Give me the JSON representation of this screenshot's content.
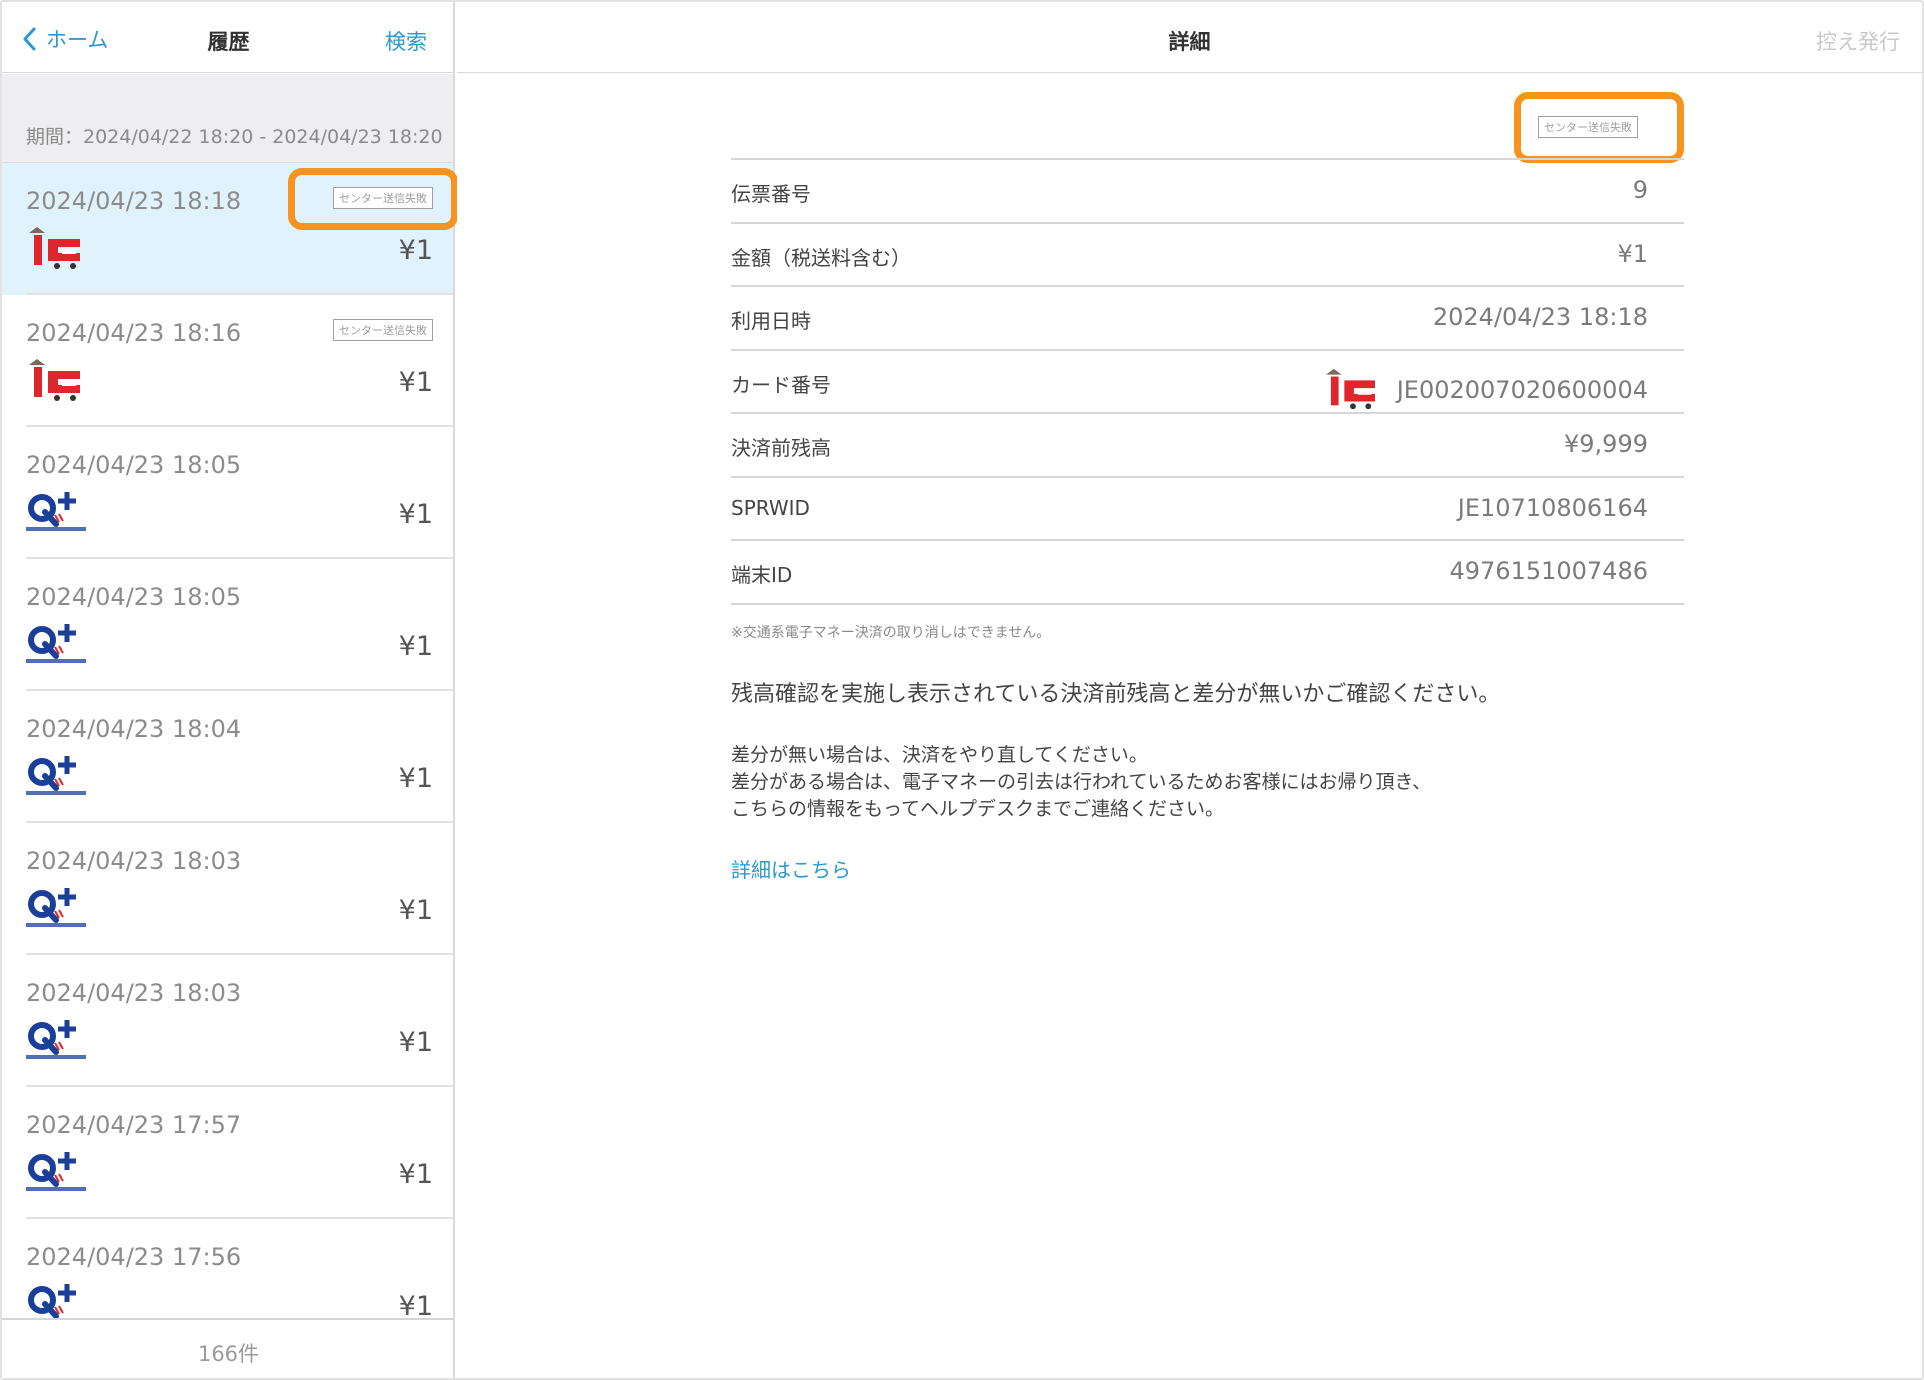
{
  "left_pane": {
    "back_label": "ホーム",
    "title": "履歴",
    "search_label": "検索",
    "period": "期間：2024/04/22 18:20 - 2024/04/23 18:20",
    "transactions": [
      {
        "time": "2024/04/23 18:18",
        "amount": "¥1",
        "logo": "ic-card-icon",
        "badge": "センター送信失敗",
        "selected": true
      },
      {
        "time": "2024/04/23 18:16",
        "amount": "¥1",
        "logo": "ic-card-icon",
        "badge": "センター送信失敗",
        "selected": false
      },
      {
        "time": "2024/04/23 18:05",
        "amount": "¥1",
        "logo": "quicpay-icon",
        "badge": "",
        "selected": false
      },
      {
        "time": "2024/04/23 18:05",
        "amount": "¥1",
        "logo": "quicpay-icon",
        "badge": "",
        "selected": false
      },
      {
        "time": "2024/04/23 18:04",
        "amount": "¥1",
        "logo": "quicpay-icon",
        "badge": "",
        "selected": false
      },
      {
        "time": "2024/04/23 18:03",
        "amount": "¥1",
        "logo": "quicpay-icon",
        "badge": "",
        "selected": false
      },
      {
        "time": "2024/04/23 18:03",
        "amount": "¥1",
        "logo": "quicpay-icon",
        "badge": "",
        "selected": false
      },
      {
        "time": "2024/04/23 17:57",
        "amount": "¥1",
        "logo": "quicpay-icon",
        "badge": "",
        "selected": false
      },
      {
        "time": "2024/04/23 17:56",
        "amount": "¥1",
        "logo": "quicpay-icon",
        "badge": "",
        "selected": false
      }
    ],
    "count": "166件"
  },
  "right_pane": {
    "title": "詳細",
    "issue_label": "控え発行",
    "status_badge": "センター送信失敗",
    "rows": [
      {
        "label": "伝票番号",
        "value": "9"
      },
      {
        "label": "金額（税送料含む）",
        "value": "¥1"
      },
      {
        "label": "利用日時",
        "value": "2024/04/23 18:18"
      },
      {
        "label": "カード番号",
        "value": "JE002007020600004",
        "logo": "ic-card-icon"
      },
      {
        "label": "決済前残高",
        "value": "¥9,999"
      },
      {
        "label": "SPRWID",
        "value": "JE10710806164"
      },
      {
        "label": "端末ID",
        "value": "4976151007486"
      }
    ],
    "note_small": "※交通系電子マネー決済の取り消しはできません。",
    "note_main": "残高確認を実施し表示されている決済前残高と差分が無いかご確認ください。",
    "note_sub": [
      "差分が無い場合は、決済をやり直してください。",
      "差分がある場合は、電子マネーの引去は行われているためお客様にはお帰り頂き、",
      "こちらの情報をもってヘルプデスクまでご連絡ください。"
    ],
    "detail_link": "詳細はこちら"
  },
  "colors": {
    "accent": "#2b9ad0",
    "highlight": "#f7931e",
    "selected_row": "#e0f3fc",
    "ic_red": "#e0262d",
    "quicpay_blue": "#1a3f99"
  }
}
